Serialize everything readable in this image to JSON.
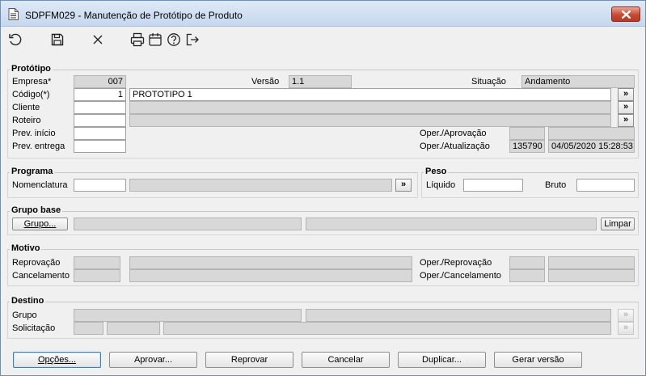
{
  "window": {
    "title": "SDPFM029 - Manutenção de Protótipo de Produto",
    "close_glyph": "x"
  },
  "toolbar": {
    "icons": [
      "refresh-icon",
      "save-icon",
      "cancel-icon",
      "print-icon",
      "calendar-icon",
      "help-icon",
      "exit-icon"
    ]
  },
  "prototipo": {
    "title": "Protótipo",
    "empresa_label": "Empresa*",
    "empresa_value": "007",
    "versao_label": "Versão",
    "versao_value": "1.1",
    "situacao_label": "Situação",
    "situacao_value": "Andamento",
    "codigo_label": "Código(*)",
    "codigo_value": "1",
    "codigo_desc": "PROTOTIPO 1",
    "cliente_label": "Cliente",
    "cliente_value": "",
    "cliente_desc": "",
    "roteiro_label": "Roteiro",
    "roteiro_value": "",
    "roteiro_desc": "",
    "prev_inicio_label": "Prev. início",
    "prev_inicio_value": "",
    "prev_entrega_label": "Prev. entrega",
    "prev_entrega_value": "",
    "oper_aprov_label": "Oper./Aprovação",
    "oper_aprov_code": "",
    "oper_aprov_date": "",
    "oper_atual_label": "Oper./Atualização",
    "oper_atual_code": "135790",
    "oper_atual_date": "04/05/2020 15:28:53",
    "lookup_glyph": "»"
  },
  "programa": {
    "title": "Programa",
    "nomenclatura_label": "Nomenclatura",
    "nomenclatura_value": "",
    "nomenclatura_desc": ""
  },
  "peso": {
    "title": "Peso",
    "liquido_label": "Líquido",
    "liquido_value": "",
    "bruto_label": "Bruto",
    "bruto_value": ""
  },
  "grupo_base": {
    "title": "Grupo base",
    "grupo_button": "Grupo...",
    "field1": "",
    "field2": "",
    "limpar_button": "Limpar"
  },
  "motivo": {
    "title": "Motivo",
    "reprovacao_label": "Reprovação",
    "cancelamento_label": "Cancelamento",
    "oper_reprov_label": "Oper./Reprovação",
    "oper_cancel_label": "Oper./Cancelamento"
  },
  "destino": {
    "title": "Destino",
    "grupo_label": "Grupo",
    "solicitacao_label": "Solicitação"
  },
  "buttons": {
    "opcoes": "Opções...",
    "aprovar": "Aprovar...",
    "reprovar": "Reprovar",
    "cancelar": "Cancelar",
    "duplicar": "Duplicar...",
    "gerar_versao": "Gerar versão"
  }
}
